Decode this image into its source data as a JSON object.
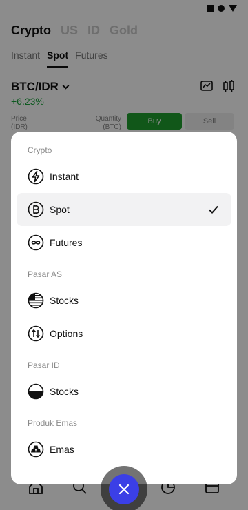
{
  "background": {
    "market_tabs": [
      "Crypto",
      "US",
      "ID",
      "Gold"
    ],
    "product_tabs": [
      "Instant",
      "Spot",
      "Futures"
    ],
    "pair": "BTC/IDR",
    "change": "+6.23%",
    "orderbook": {
      "price_label": "Price",
      "price_unit": "(IDR)",
      "quantity_label": "Quantity",
      "quantity_unit": "(BTC)",
      "buy_label": "Buy",
      "sell_label": "Sell"
    }
  },
  "sheet": {
    "sections": [
      {
        "label": "Crypto"
      },
      {
        "label": "Pasar AS"
      },
      {
        "label": "Pasar ID"
      },
      {
        "label": "Produk Emas"
      }
    ],
    "options": [
      {
        "label": "Instant",
        "icon": "lightning-icon",
        "selected": false
      },
      {
        "label": "Spot",
        "icon": "bitcoin-icon",
        "selected": true
      },
      {
        "label": "Futures",
        "icon": "infinity-icon",
        "selected": false
      },
      {
        "label": "Stocks",
        "icon": "us-flag-icon",
        "selected": false
      },
      {
        "label": "Options",
        "icon": "arrows-updown-icon",
        "selected": false
      },
      {
        "label": "Stocks",
        "icon": "id-flag-icon",
        "selected": false
      },
      {
        "label": "Emas",
        "icon": "gold-bars-icon",
        "selected": false
      }
    ]
  },
  "colors": {
    "accent": "#3b3fe6",
    "positive": "#1aa33b",
    "buy": "#1f9f2f"
  }
}
